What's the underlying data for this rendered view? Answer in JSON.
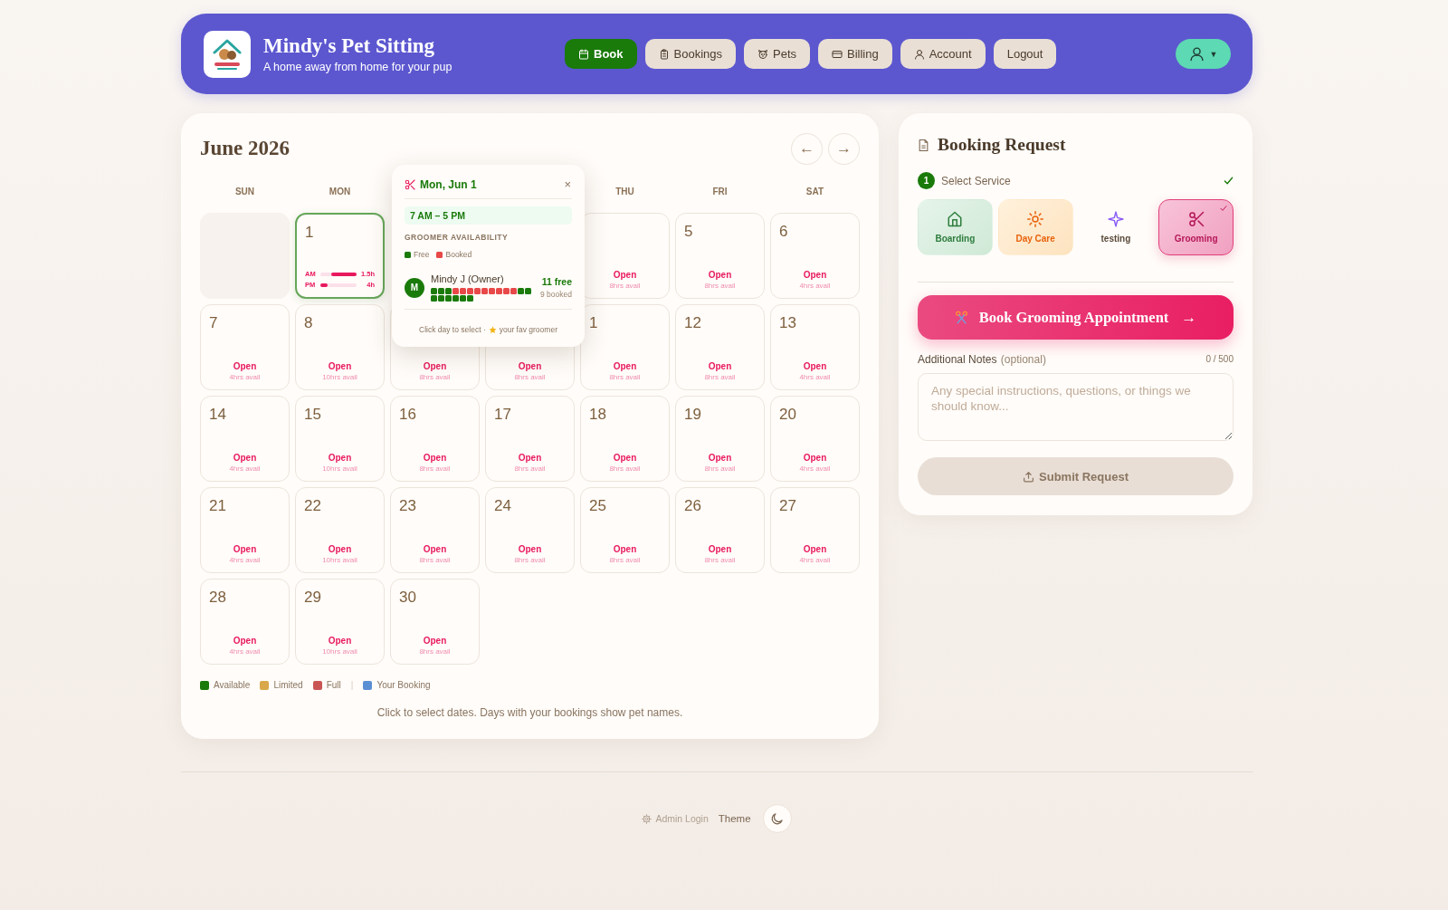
{
  "header": {
    "title": "Mindy's Pet Sitting",
    "subtitle": "A home away from home for your pup",
    "nav": [
      {
        "kind": "book",
        "label": "Book",
        "selected": true
      },
      {
        "kind": "bookings",
        "label": "Bookings",
        "selected": false
      },
      {
        "kind": "pets",
        "label": "Pets",
        "selected": false
      },
      {
        "kind": "billing",
        "label": "Billing",
        "selected": false
      },
      {
        "kind": "account",
        "label": "Account",
        "selected": false
      },
      {
        "kind": "logout",
        "label": "Logout",
        "selected": false
      }
    ],
    "user_menu": {
      "caret": "▼"
    }
  },
  "calendar": {
    "title": "June 2026",
    "prev": "←",
    "next": "→",
    "weekdays": [
      {
        "kind": "label",
        "label": "SUN"
      },
      {
        "kind": "label",
        "label": "MON"
      },
      {
        "kind": "hidden"
      },
      {
        "kind": "hidden"
      },
      {
        "kind": "label",
        "label": "THU"
      },
      {
        "kind": "label",
        "label": "FRI"
      },
      {
        "kind": "label",
        "label": "SAT"
      }
    ],
    "weeks": [
      [
        {
          "kind": "blank"
        },
        {
          "kind": "detail",
          "day": "1",
          "selected": true,
          "bars": [
            {
              "label": "AM",
              "level": 0.7,
              "from_end": true,
              "reading": "1.5h"
            },
            {
              "label": "PM",
              "level": 0.2,
              "from_end": false,
              "reading": "4h"
            }
          ]
        },
        {
          "kind": "hidden"
        },
        {
          "kind": "hidden"
        },
        {
          "kind": "day",
          "selected": false,
          "status": "Open",
          "avail": "8hrs avail"
        },
        {
          "kind": "day",
          "day": "5",
          "selected": false,
          "status": "Open",
          "avail": "8hrs avail"
        },
        {
          "kind": "day",
          "day": "6",
          "selected": false,
          "status": "Open",
          "avail": "4hrs avail"
        }
      ],
      [
        {
          "kind": "day",
          "day": "7",
          "selected": false,
          "status": "Open",
          "avail": "4hrs avail"
        },
        {
          "kind": "day",
          "day": "8",
          "selected": false,
          "status": "Open",
          "avail": "10hrs avail"
        },
        {
          "kind": "day",
          "selected": false,
          "status": "Open",
          "avail": "8hrs avail"
        },
        {
          "kind": "day",
          "selected": false,
          "status": "Open",
          "avail": "8hrs avail"
        },
        {
          "kind": "day",
          "day": "1",
          "selected": false,
          "status": "Open",
          "avail": "8hrs avail"
        },
        {
          "kind": "day",
          "day": "12",
          "selected": false,
          "status": "Open",
          "avail": "8hrs avail"
        },
        {
          "kind": "day",
          "day": "13",
          "selected": false,
          "status": "Open",
          "avail": "4hrs avail"
        }
      ],
      [
        {
          "kind": "day",
          "day": "14",
          "selected": false,
          "status": "Open",
          "avail": "4hrs avail"
        },
        {
          "kind": "day",
          "day": "15",
          "selected": false,
          "status": "Open",
          "avail": "10hrs avail"
        },
        {
          "kind": "day",
          "day": "16",
          "selected": false,
          "status": "Open",
          "avail": "8hrs avail"
        },
        {
          "kind": "day",
          "day": "17",
          "selected": false,
          "status": "Open",
          "avail": "8hrs avail"
        },
        {
          "kind": "day",
          "day": "18",
          "selected": false,
          "status": "Open",
          "avail": "8hrs avail"
        },
        {
          "kind": "day",
          "day": "19",
          "selected": false,
          "status": "Open",
          "avail": "8hrs avail"
        },
        {
          "kind": "day",
          "day": "20",
          "selected": false,
          "status": "Open",
          "avail": "4hrs avail"
        }
      ],
      [
        {
          "kind": "day",
          "day": "21",
          "selected": false,
          "status": "Open",
          "avail": "4hrs avail"
        },
        {
          "kind": "day",
          "day": "22",
          "selected": false,
          "status": "Open",
          "avail": "10hrs avail"
        },
        {
          "kind": "day",
          "day": "23",
          "selected": false,
          "status": "Open",
          "avail": "8hrs avail"
        },
        {
          "kind": "day",
          "day": "24",
          "selected": false,
          "status": "Open",
          "avail": "8hrs avail"
        },
        {
          "kind": "day",
          "day": "25",
          "selected": false,
          "status": "Open",
          "avail": "8hrs avail"
        },
        {
          "kind": "day",
          "day": "26",
          "selected": false,
          "status": "Open",
          "avail": "8hrs avail"
        },
        {
          "kind": "day",
          "day": "27",
          "selected": false,
          "status": "Open",
          "avail": "4hrs avail"
        }
      ],
      [
        {
          "kind": "day",
          "day": "28",
          "selected": false,
          "status": "Open",
          "avail": "4hrs avail"
        },
        {
          "kind": "day",
          "day": "29",
          "selected": false,
          "status": "Open",
          "avail": "10hrs avail"
        },
        {
          "kind": "day",
          "day": "30",
          "selected": false,
          "status": "Open",
          "avail": "8hrs avail"
        }
      ]
    ],
    "popover": {
      "title": "Mon, Jun 1",
      "close": "×",
      "hours": "7 AM – 5 PM",
      "section": "GROOMER AVAILABILITY",
      "legend": [
        {
          "label": "Free",
          "color": "#1a7a0a"
        },
        {
          "label": "Booked",
          "color": "#e84848"
        }
      ],
      "groomers": [
        {
          "initial": "M",
          "name": "Mindy J (Owner)",
          "free": "11 free",
          "booked": "9 booked",
          "slots": [
            {
              "booked": false
            },
            {
              "booked": false
            },
            {
              "booked": false
            },
            {
              "booked": true
            },
            {
              "booked": true
            },
            {
              "booked": true
            },
            {
              "booked": true
            },
            {
              "booked": true
            },
            {
              "booked": true
            },
            {
              "booked": true
            },
            {
              "booked": true
            },
            {
              "booked": true
            },
            {
              "booked": false
            },
            {
              "booked": false
            },
            {
              "booked": false
            },
            {
              "booked": false
            },
            {
              "booked": false
            },
            {
              "booked": false
            },
            {
              "booked": false
            },
            {
              "booked": false
            }
          ]
        }
      ],
      "footer_before": "Click day to select ·",
      "footer_after": "your fav groomer"
    },
    "legend": {
      "groups": [
        [
          {
            "label": "Available",
            "color": "#1a7a0a"
          },
          {
            "label": "Limited",
            "color": "#d9a84a"
          },
          {
            "label": "Full",
            "color": "#c95454"
          }
        ],
        [
          {
            "label": "Your Booking",
            "color": "#5b8fd4"
          }
        ]
      ],
      "separator": "|"
    },
    "hint": "Click to select dates. Days with your bookings show pet names."
  },
  "booking": {
    "title": "Booking Request",
    "step": {
      "number": "1",
      "label": "Select Service",
      "done": true
    },
    "services": [
      {
        "kind": "boarding",
        "label": "Boarding",
        "selected": false
      },
      {
        "kind": "daycare",
        "label": "Day Care",
        "selected": false
      },
      {
        "kind": "custom",
        "label": "testing",
        "selected": false
      },
      {
        "kind": "grooming",
        "label": "Grooming",
        "selected": true
      }
    ],
    "action": {
      "label": "Book Grooming Appointment",
      "arrow": "→"
    },
    "notes": {
      "label": "Additional Notes",
      "optional": "(optional)",
      "counter": "0 / 500",
      "placeholder": "Any special instructions, questions, or things we should know..."
    },
    "submit": {
      "label": "Submit Request",
      "disabled": true
    }
  },
  "footer": {
    "admin": "Admin Login",
    "theme": "Theme"
  }
}
